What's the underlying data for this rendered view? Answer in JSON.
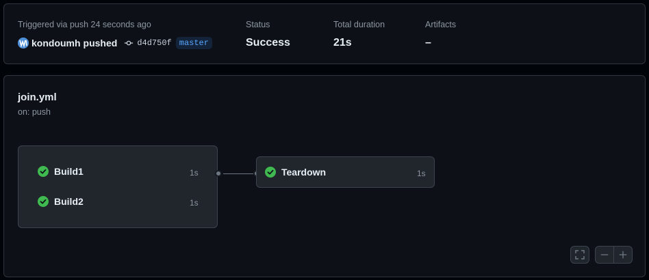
{
  "summary": {
    "trigger_text": "Triggered via push 24 seconds ago",
    "actor": "kondoumh",
    "action": "pushed",
    "commit_sha": "d4d750f",
    "branch": "master",
    "status_label": "Status",
    "status_value": "Success",
    "duration_label": "Total duration",
    "duration_value": "21s",
    "artifacts_label": "Artifacts",
    "artifacts_value": "–"
  },
  "workflow": {
    "filename": "join.yml",
    "trigger": "on: push",
    "group_jobs": [
      {
        "name": "Build1",
        "duration": "1s",
        "status": "success"
      },
      {
        "name": "Build2",
        "duration": "1s",
        "status": "success"
      }
    ],
    "next_job": {
      "name": "Teardown",
      "duration": "1s",
      "status": "success"
    }
  },
  "controls": {
    "fullscreen_icon": "fullscreen-icon",
    "zoom_out_icon": "minus-icon",
    "zoom_in_icon": "plus-icon"
  },
  "colors": {
    "success": "#3fb950",
    "background": "#010409",
    "card": "#0d1117",
    "job_box": "#21262d",
    "branch_text": "#58a6ff"
  }
}
